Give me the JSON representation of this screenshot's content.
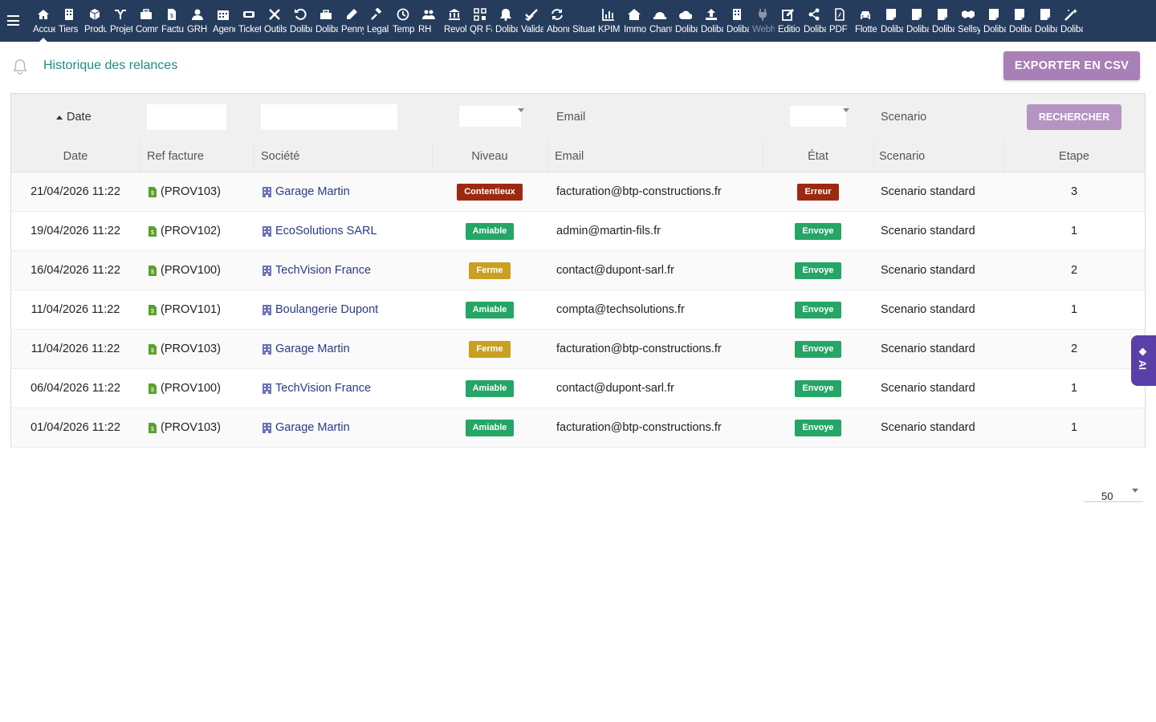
{
  "nav": {
    "items": [
      {
        "label": "Accueil",
        "icon": "home-icon"
      },
      {
        "label": "Tiers",
        "icon": "building-icon"
      },
      {
        "label": "Produits",
        "icon": "cube-icon"
      },
      {
        "label": "Projets",
        "icon": "project-icon"
      },
      {
        "label": "Commerce",
        "icon": "briefcase-icon"
      },
      {
        "label": "Facturation",
        "icon": "invoice-icon"
      },
      {
        "label": "GRH",
        "icon": "user-icon"
      },
      {
        "label": "Agenda",
        "icon": "calendar-icon"
      },
      {
        "label": "Tickets",
        "icon": "ticket-icon"
      },
      {
        "label": "Outils",
        "icon": "tools-icon"
      },
      {
        "label": "Dolibarr",
        "icon": "undo-icon"
      },
      {
        "label": "Dolibarr",
        "icon": "toolbox-icon"
      },
      {
        "label": "Penny",
        "icon": "pen-icon"
      },
      {
        "label": "Legal",
        "icon": "gavel-icon"
      },
      {
        "label": "Temps",
        "icon": "clock-icon"
      },
      {
        "label": "RH",
        "icon": "users-icon"
      },
      {
        "label": "Revolut",
        "icon": "bank-icon"
      },
      {
        "label": "QR Facture",
        "icon": "qrcode-icon"
      },
      {
        "label": "Dolibarr",
        "icon": "bell-icon"
      },
      {
        "label": "Validation",
        "icon": "check-icon"
      },
      {
        "label": "Abonnements",
        "icon": "sync-icon"
      },
      {
        "label": "Situation",
        "icon": "blank-icon"
      },
      {
        "label": "KPIM",
        "icon": "chart-icon"
      },
      {
        "label": "Immobilier",
        "icon": "house-icon"
      },
      {
        "label": "Chantiers",
        "icon": "helmet-icon"
      },
      {
        "label": "Dolibarr",
        "icon": "cloud-icon"
      },
      {
        "label": "Dolibarr",
        "icon": "upload-icon"
      },
      {
        "label": "Dolibarr",
        "icon": "building-icon"
      },
      {
        "label": "Webhook",
        "icon": "plug-icon",
        "dim": true
      },
      {
        "label": "Edition",
        "icon": "edit-icon"
      },
      {
        "label": "Dolibarr",
        "icon": "share-icon"
      },
      {
        "label": "PDF",
        "icon": "pdf-icon"
      },
      {
        "label": "Flotte",
        "icon": "car-icon"
      },
      {
        "label": "Dolibarr",
        "icon": "note-icon"
      },
      {
        "label": "Dolibarr",
        "icon": "note-icon"
      },
      {
        "label": "Dolibarr",
        "icon": "note-icon"
      },
      {
        "label": "Sellsy",
        "icon": "handshake-icon"
      },
      {
        "label": "Dolibarr",
        "icon": "note-icon"
      },
      {
        "label": "Dolibarr",
        "icon": "note-icon"
      },
      {
        "label": "Dolibarr",
        "icon": "note-icon"
      },
      {
        "label": "Dolibarr",
        "icon": "magic-icon"
      }
    ]
  },
  "header": {
    "title": "Historique des relances",
    "export_label": "EXPORTER EN CSV"
  },
  "filters": {
    "sort_label": "Date",
    "email_placeholder": "Email",
    "scenario_placeholder": "Scenario",
    "search_label": "RECHERCHER"
  },
  "columns": [
    "Date",
    "Ref facture",
    "Société",
    "Niveau",
    "Email",
    "État",
    "Scenario",
    "Etape"
  ],
  "colors": {
    "Contentieux": "#9c2a10",
    "Amiable": "#25a566",
    "Ferme": "#c9a022",
    "Erreur": "#9c2a10",
    "Envoye": "#25a566"
  },
  "rows": [
    {
      "date": "21/04/2026 11:22",
      "ref": "(PROV103)",
      "societe": "Garage Martin",
      "niveau": "Contentieux",
      "email": "facturation@btp-constructions.fr",
      "etat": "Erreur",
      "scenario": "Scenario standard",
      "etape": "3"
    },
    {
      "date": "19/04/2026 11:22",
      "ref": "(PROV102)",
      "societe": "EcoSolutions SARL",
      "niveau": "Amiable",
      "email": "admin@martin-fils.fr",
      "etat": "Envoye",
      "scenario": "Scenario standard",
      "etape": "1"
    },
    {
      "date": "16/04/2026 11:22",
      "ref": "(PROV100)",
      "societe": "TechVision France",
      "niveau": "Ferme",
      "email": "contact@dupont-sarl.fr",
      "etat": "Envoye",
      "scenario": "Scenario standard",
      "etape": "2"
    },
    {
      "date": "11/04/2026 11:22",
      "ref": "(PROV101)",
      "societe": "Boulangerie Dupont",
      "niveau": "Amiable",
      "email": "compta@techsolutions.fr",
      "etat": "Envoye",
      "scenario": "Scenario standard",
      "etape": "1"
    },
    {
      "date": "11/04/2026 11:22",
      "ref": "(PROV103)",
      "societe": "Garage Martin",
      "niveau": "Ferme",
      "email": "facturation@btp-constructions.fr",
      "etat": "Envoye",
      "scenario": "Scenario standard",
      "etape": "2"
    },
    {
      "date": "06/04/2026 11:22",
      "ref": "(PROV100)",
      "societe": "TechVision France",
      "niveau": "Amiable",
      "email": "contact@dupont-sarl.fr",
      "etat": "Envoye",
      "scenario": "Scenario standard",
      "etape": "1"
    },
    {
      "date": "01/04/2026 11:22",
      "ref": "(PROV103)",
      "societe": "Garage Martin",
      "niveau": "Amiable",
      "email": "facturation@btp-constructions.fr",
      "etat": "Envoye",
      "scenario": "Scenario standard",
      "etape": "1"
    }
  ],
  "pager": {
    "page_size": "50"
  },
  "ai_tab": {
    "label": "AI"
  }
}
